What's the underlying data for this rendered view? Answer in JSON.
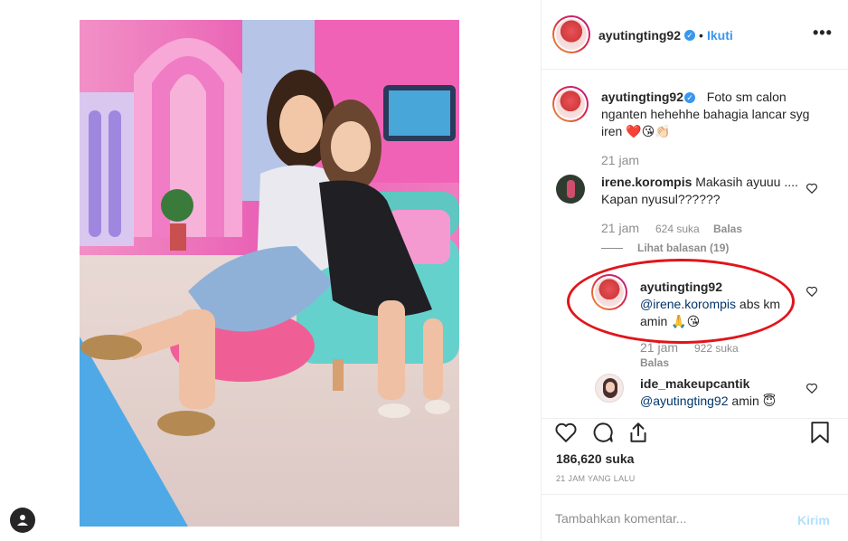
{
  "colors": {
    "accent": "#3897f0",
    "text": "#262626",
    "muted": "#8e8e8e",
    "annotation": "#e0151b",
    "send_disabled": "#b2dffc"
  },
  "header": {
    "username": "ayutingting92",
    "separator": "•",
    "follow_label": "Ikuti",
    "more_icon": "more-horizontal-icon"
  },
  "caption": {
    "username": "ayutingting92",
    "text_line1": "Foto sm calon",
    "text_line2": "nganten hehehhe bahagia lancar syg",
    "text_line3": "iren ❤️😘👏🏻",
    "time": "21 jam"
  },
  "comments": [
    {
      "username": "irene.korompis",
      "text_line1": "Makasih ayuuu ....",
      "text_line2": "Kapan nyusul??????",
      "time": "21 jam",
      "likes": "624 suka",
      "reply_label": "Balas",
      "view_replies": "Lihat balasan (19)"
    },
    {
      "username": "ayutingting92",
      "mention": "@irene.korompis",
      "text_after_mention": " abs km",
      "text_line2": "amin 🙏😘",
      "time": "21 jam",
      "likes": "922 suka",
      "reply_label": "Balas"
    },
    {
      "username": "ide_makeupcantik",
      "mention": "@ayutingting92",
      "text_after_mention": " amin 😇"
    }
  ],
  "actions": {
    "likes_count": "186,620 suka",
    "time_ago": "21 JAM YANG LALU"
  },
  "comment_input": {
    "placeholder": "Tambahkan komentar...",
    "send_label": "Kirim"
  }
}
